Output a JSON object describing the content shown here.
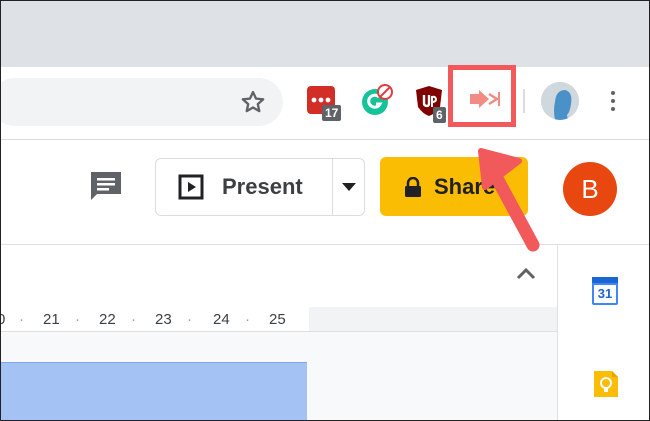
{
  "browser": {
    "extensions": [
      {
        "name": "lastpass",
        "badge": "17",
        "color": "#d32d27"
      },
      {
        "name": "grammarly",
        "color": "#15c39a"
      },
      {
        "name": "ublock-origin",
        "badge": "6",
        "color": "#800000"
      },
      {
        "name": "presentation-extension",
        "color": "#f28b82",
        "highlighted": true
      }
    ]
  },
  "app": {
    "present_label": "Present",
    "share_label": "Share",
    "share_color": "#fbbc04",
    "user_initial": "B",
    "user_color": "#e8470f"
  },
  "ruler": {
    "ticks": [
      "0",
      "21",
      "22",
      "23",
      "24",
      "25"
    ]
  },
  "side_panel": {
    "calendar_day": "31"
  },
  "annotation": {
    "highlight_color": "#f1595b"
  }
}
